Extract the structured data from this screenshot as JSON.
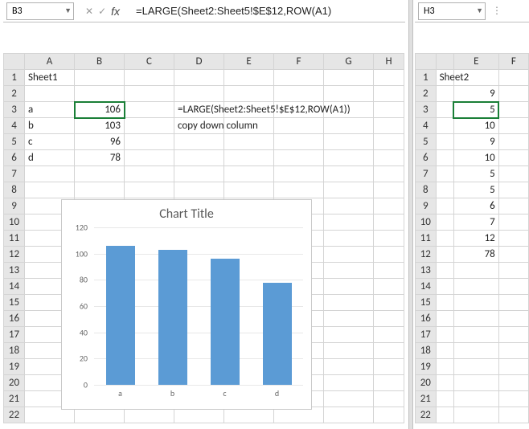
{
  "left": {
    "name_box": "B3",
    "formula": "=LARGE(Sheet2:Sheet5!$E$12,ROW(A1)",
    "sheet_label": "Sheet1",
    "cols": [
      "A",
      "B",
      "C",
      "D",
      "E",
      "F",
      "G",
      "H"
    ],
    "rownums": [
      1,
      2,
      3,
      4,
      5,
      6,
      7,
      8,
      9,
      10,
      11,
      12,
      13,
      14,
      15,
      16,
      17,
      18,
      19,
      20,
      21,
      22
    ],
    "rows": [
      {
        "A": "a",
        "B": "106",
        "D": "=LARGE(Sheet2:Sheet5!$E$12,ROW(A1))"
      },
      {
        "A": "b",
        "B": "103",
        "D": "copy down column"
      },
      {
        "A": "c",
        "B": "96"
      },
      {
        "A": "d",
        "B": "78"
      }
    ]
  },
  "right": {
    "name_box": "H3",
    "sheet_label": "Sheet2",
    "cols": [
      "",
      "E",
      "F"
    ],
    "rownums": [
      1,
      2,
      3,
      4,
      5,
      6,
      7,
      8,
      9,
      10,
      11,
      12,
      13,
      14,
      15,
      16,
      17,
      18,
      19,
      20,
      21,
      22
    ],
    "values": {
      "2": "9",
      "3": "5",
      "4": "10",
      "5": "9",
      "6": "10",
      "7": "5",
      "8": "5",
      "9": "6",
      "10": "7",
      "11": "12",
      "12": "78"
    },
    "active_row": 3
  },
  "chart_data": {
    "type": "bar",
    "title": "Chart Title",
    "categories": [
      "a",
      "b",
      "c",
      "d"
    ],
    "values": [
      106,
      103,
      96,
      78
    ],
    "ylim": [
      0,
      120
    ],
    "yticks": [
      0,
      20,
      40,
      60,
      80,
      100,
      120
    ],
    "xlabel": "",
    "ylabel": ""
  }
}
